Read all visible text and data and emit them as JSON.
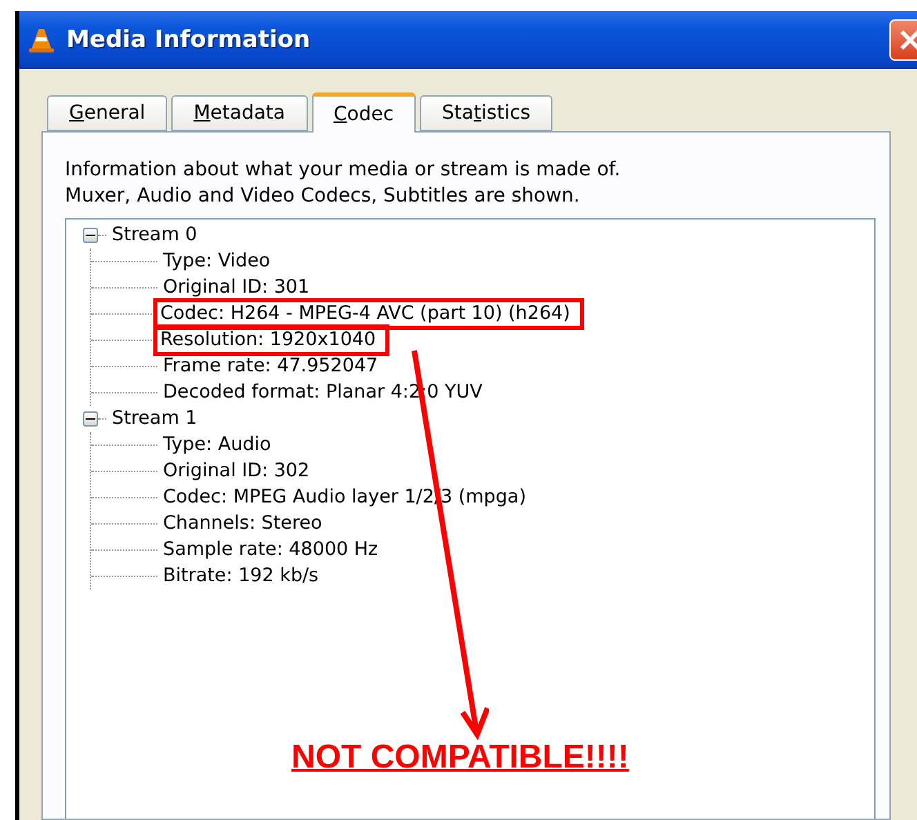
{
  "window": {
    "title": "Media Information"
  },
  "tabs": [
    {
      "access_key": "G",
      "after_key": "eneral",
      "selected": false
    },
    {
      "access_key": "M",
      "after_key": "etadata",
      "selected": false
    },
    {
      "access_key": "C",
      "after_key": "odec",
      "selected": true
    },
    {
      "before_key": "Sta",
      "access_key": "t",
      "after_key": "istics",
      "selected": false
    }
  ],
  "description": [
    "Information about what your media or stream is made of.",
    "Muxer, Audio and Video Codecs, Subtitles are shown."
  ],
  "tree": [
    {
      "label": "Stream 0",
      "expanded": true,
      "children": [
        {
          "label": "Type: Video",
          "highlighted": false
        },
        {
          "label": "Original ID: 301",
          "highlighted": false
        },
        {
          "label": "Codec: H264 - MPEG-4 AVC (part 10) (h264)",
          "highlighted": true
        },
        {
          "label": "Resolution: 1920x1040",
          "highlighted": true
        },
        {
          "label": "Frame rate: 47.952047",
          "highlighted": false
        },
        {
          "label": "Decoded format: Planar 4:2:0 YUV",
          "highlighted": false
        }
      ]
    },
    {
      "label": "Stream 1",
      "expanded": true,
      "children": [
        {
          "label": "Type: Audio",
          "highlighted": false
        },
        {
          "label": "Original ID: 302",
          "highlighted": false
        },
        {
          "label": "Codec: MPEG Audio layer 1/2/3 (mpga)",
          "highlighted": false
        },
        {
          "label": "Channels: Stereo",
          "highlighted": false
        },
        {
          "label": "Sample rate: 48000 Hz",
          "highlighted": false
        },
        {
          "label": "Bitrate: 192 kb/s",
          "highlighted": false
        }
      ]
    }
  ],
  "annotation": {
    "text": "NOT COMPATIBLE!!!!"
  }
}
